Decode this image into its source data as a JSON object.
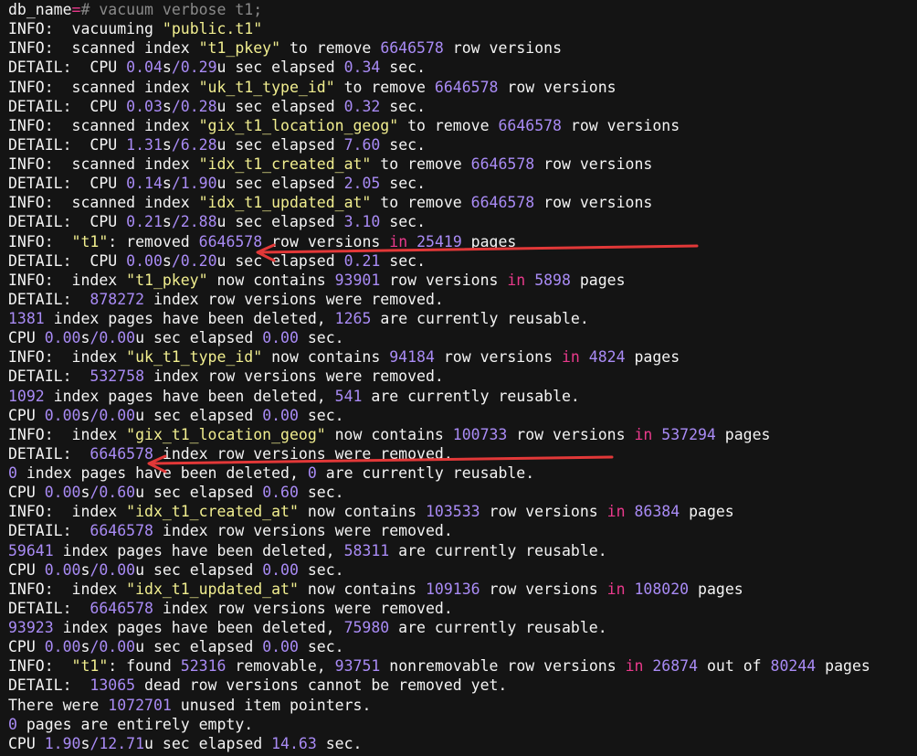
{
  "colors": {
    "background": "#141414",
    "text": "#f4f4f4",
    "string": "#f1ee8f",
    "number": "#a98bf5",
    "keyword_in": "#ea3a8c",
    "command": "#8a8a8a",
    "annotation_arrow": "#e23838"
  },
  "terminal": {
    "lines": [
      {
        "segments": [
          {
            "t": "db_name",
            "c": "t"
          },
          {
            "t": "=",
            "c": "o"
          },
          {
            "t": "# vacuum verbose t1;",
            "c": "c"
          }
        ]
      },
      {
        "segments": [
          {
            "t": "INFO:  vacuuming ",
            "c": "t"
          },
          {
            "t": "\"public.t1\"",
            "c": "s"
          }
        ]
      },
      {
        "segments": [
          {
            "t": "INFO:  scanned index ",
            "c": "t"
          },
          {
            "t": "\"t1_pkey\"",
            "c": "s"
          },
          {
            "t": " to remove ",
            "c": "t"
          },
          {
            "t": "6646578",
            "c": "n"
          },
          {
            "t": " row versions",
            "c": "t"
          }
        ]
      },
      {
        "segments": [
          {
            "t": "DETAIL:  CPU ",
            "c": "t"
          },
          {
            "t": "0.04",
            "c": "n"
          },
          {
            "t": "s",
            "c": "t"
          },
          {
            "t": "/0.29",
            "c": "n"
          },
          {
            "t": "u sec elapsed ",
            "c": "t"
          },
          {
            "t": "0.34",
            "c": "n"
          },
          {
            "t": " sec.",
            "c": "t"
          }
        ]
      },
      {
        "segments": [
          {
            "t": "INFO:  scanned index ",
            "c": "t"
          },
          {
            "t": "\"uk_t1_type_id\"",
            "c": "s"
          },
          {
            "t": " to remove ",
            "c": "t"
          },
          {
            "t": "6646578",
            "c": "n"
          },
          {
            "t": " row versions",
            "c": "t"
          }
        ]
      },
      {
        "segments": [
          {
            "t": "DETAIL:  CPU ",
            "c": "t"
          },
          {
            "t": "0.03",
            "c": "n"
          },
          {
            "t": "s",
            "c": "t"
          },
          {
            "t": "/0.28",
            "c": "n"
          },
          {
            "t": "u sec elapsed ",
            "c": "t"
          },
          {
            "t": "0.32",
            "c": "n"
          },
          {
            "t": " sec.",
            "c": "t"
          }
        ]
      },
      {
        "segments": [
          {
            "t": "INFO:  scanned index ",
            "c": "t"
          },
          {
            "t": "\"gix_t1_location_geog\"",
            "c": "s"
          },
          {
            "t": " to remove ",
            "c": "t"
          },
          {
            "t": "6646578",
            "c": "n"
          },
          {
            "t": " row versions",
            "c": "t"
          }
        ]
      },
      {
        "segments": [
          {
            "t": "DETAIL:  CPU ",
            "c": "t"
          },
          {
            "t": "1.31",
            "c": "n"
          },
          {
            "t": "s",
            "c": "t"
          },
          {
            "t": "/6.28",
            "c": "n"
          },
          {
            "t": "u sec elapsed ",
            "c": "t"
          },
          {
            "t": "7.60",
            "c": "n"
          },
          {
            "t": " sec.",
            "c": "t"
          }
        ]
      },
      {
        "segments": [
          {
            "t": "INFO:  scanned index ",
            "c": "t"
          },
          {
            "t": "\"idx_t1_created_at\"",
            "c": "s"
          },
          {
            "t": " to remove ",
            "c": "t"
          },
          {
            "t": "6646578",
            "c": "n"
          },
          {
            "t": " row versions",
            "c": "t"
          }
        ]
      },
      {
        "segments": [
          {
            "t": "DETAIL:  CPU ",
            "c": "t"
          },
          {
            "t": "0.14",
            "c": "n"
          },
          {
            "t": "s",
            "c": "t"
          },
          {
            "t": "/1.90",
            "c": "n"
          },
          {
            "t": "u sec elapsed ",
            "c": "t"
          },
          {
            "t": "2.05",
            "c": "n"
          },
          {
            "t": " sec.",
            "c": "t"
          }
        ]
      },
      {
        "segments": [
          {
            "t": "INFO:  scanned index ",
            "c": "t"
          },
          {
            "t": "\"idx_t1_updated_at\"",
            "c": "s"
          },
          {
            "t": " to remove ",
            "c": "t"
          },
          {
            "t": "6646578",
            "c": "n"
          },
          {
            "t": " row versions",
            "c": "t"
          }
        ]
      },
      {
        "segments": [
          {
            "t": "DETAIL:  CPU ",
            "c": "t"
          },
          {
            "t": "0.21",
            "c": "n"
          },
          {
            "t": "s",
            "c": "t"
          },
          {
            "t": "/2.88",
            "c": "n"
          },
          {
            "t": "u sec elapsed ",
            "c": "t"
          },
          {
            "t": "3.10",
            "c": "n"
          },
          {
            "t": " sec.",
            "c": "t"
          }
        ]
      },
      {
        "segments": [
          {
            "t": "INFO:  ",
            "c": "t"
          },
          {
            "t": "\"t1\"",
            "c": "s"
          },
          {
            "t": ": removed ",
            "c": "t"
          },
          {
            "t": "6646578",
            "c": "n"
          },
          {
            "t": " row versions ",
            "c": "t"
          },
          {
            "t": "in",
            "c": "k"
          },
          {
            "t": " ",
            "c": "t"
          },
          {
            "t": "25419",
            "c": "n"
          },
          {
            "t": " pages",
            "c": "t"
          }
        ]
      },
      {
        "segments": [
          {
            "t": "DETAIL:  CPU ",
            "c": "t"
          },
          {
            "t": "0.00",
            "c": "n"
          },
          {
            "t": "s",
            "c": "t"
          },
          {
            "t": "/0.20",
            "c": "n"
          },
          {
            "t": "u sec elapsed ",
            "c": "t"
          },
          {
            "t": "0.21",
            "c": "n"
          },
          {
            "t": " sec.",
            "c": "t"
          }
        ]
      },
      {
        "segments": [
          {
            "t": "INFO:  index ",
            "c": "t"
          },
          {
            "t": "\"t1_pkey\"",
            "c": "s"
          },
          {
            "t": " now contains ",
            "c": "t"
          },
          {
            "t": "93901",
            "c": "n"
          },
          {
            "t": " row versions ",
            "c": "t"
          },
          {
            "t": "in",
            "c": "k"
          },
          {
            "t": " ",
            "c": "t"
          },
          {
            "t": "5898",
            "c": "n"
          },
          {
            "t": " pages",
            "c": "t"
          }
        ]
      },
      {
        "segments": [
          {
            "t": "DETAIL:  ",
            "c": "t"
          },
          {
            "t": "878272",
            "c": "n"
          },
          {
            "t": " index row versions were removed.",
            "c": "t"
          }
        ]
      },
      {
        "segments": [
          {
            "t": "1381",
            "c": "n"
          },
          {
            "t": " index pages have been deleted, ",
            "c": "t"
          },
          {
            "t": "1265",
            "c": "n"
          },
          {
            "t": " are currently reusable.",
            "c": "t"
          }
        ]
      },
      {
        "segments": [
          {
            "t": "CPU ",
            "c": "t"
          },
          {
            "t": "0.00",
            "c": "n"
          },
          {
            "t": "s",
            "c": "t"
          },
          {
            "t": "/0.00",
            "c": "n"
          },
          {
            "t": "u sec elapsed ",
            "c": "t"
          },
          {
            "t": "0.00",
            "c": "n"
          },
          {
            "t": " sec.",
            "c": "t"
          }
        ]
      },
      {
        "segments": [
          {
            "t": "INFO:  index ",
            "c": "t"
          },
          {
            "t": "\"uk_t1_type_id\"",
            "c": "s"
          },
          {
            "t": " now contains ",
            "c": "t"
          },
          {
            "t": "94184",
            "c": "n"
          },
          {
            "t": " row versions ",
            "c": "t"
          },
          {
            "t": "in",
            "c": "k"
          },
          {
            "t": " ",
            "c": "t"
          },
          {
            "t": "4824",
            "c": "n"
          },
          {
            "t": " pages",
            "c": "t"
          }
        ]
      },
      {
        "segments": [
          {
            "t": "DETAIL:  ",
            "c": "t"
          },
          {
            "t": "532758",
            "c": "n"
          },
          {
            "t": " index row versions were removed.",
            "c": "t"
          }
        ]
      },
      {
        "segments": [
          {
            "t": "1092",
            "c": "n"
          },
          {
            "t": " index pages have been deleted, ",
            "c": "t"
          },
          {
            "t": "541",
            "c": "n"
          },
          {
            "t": " are currently reusable.",
            "c": "t"
          }
        ]
      },
      {
        "segments": [
          {
            "t": "CPU ",
            "c": "t"
          },
          {
            "t": "0.00",
            "c": "n"
          },
          {
            "t": "s",
            "c": "t"
          },
          {
            "t": "/0.00",
            "c": "n"
          },
          {
            "t": "u sec elapsed ",
            "c": "t"
          },
          {
            "t": "0.00",
            "c": "n"
          },
          {
            "t": " sec.",
            "c": "t"
          }
        ]
      },
      {
        "segments": [
          {
            "t": "INFO:  index ",
            "c": "t"
          },
          {
            "t": "\"gix_t1_location_geog\"",
            "c": "s"
          },
          {
            "t": " now contains ",
            "c": "t"
          },
          {
            "t": "100733",
            "c": "n"
          },
          {
            "t": " row versions ",
            "c": "t"
          },
          {
            "t": "in",
            "c": "k"
          },
          {
            "t": " ",
            "c": "t"
          },
          {
            "t": "537294",
            "c": "n"
          },
          {
            "t": " pages",
            "c": "t"
          }
        ]
      },
      {
        "segments": [
          {
            "t": "DETAIL:  ",
            "c": "t"
          },
          {
            "t": "6646578",
            "c": "n"
          },
          {
            "t": " index row versions were removed.",
            "c": "t"
          }
        ]
      },
      {
        "segments": [
          {
            "t": "0",
            "c": "n"
          },
          {
            "t": " index pages have been deleted, ",
            "c": "t"
          },
          {
            "t": "0",
            "c": "n"
          },
          {
            "t": " are currently reusable.",
            "c": "t"
          }
        ]
      },
      {
        "segments": [
          {
            "t": "CPU ",
            "c": "t"
          },
          {
            "t": "0.00",
            "c": "n"
          },
          {
            "t": "s",
            "c": "t"
          },
          {
            "t": "/0.60",
            "c": "n"
          },
          {
            "t": "u sec elapsed ",
            "c": "t"
          },
          {
            "t": "0.60",
            "c": "n"
          },
          {
            "t": " sec.",
            "c": "t"
          }
        ]
      },
      {
        "segments": [
          {
            "t": "INFO:  index ",
            "c": "t"
          },
          {
            "t": "\"idx_t1_created_at\"",
            "c": "s"
          },
          {
            "t": " now contains ",
            "c": "t"
          },
          {
            "t": "103533",
            "c": "n"
          },
          {
            "t": " row versions ",
            "c": "t"
          },
          {
            "t": "in",
            "c": "k"
          },
          {
            "t": " ",
            "c": "t"
          },
          {
            "t": "86384",
            "c": "n"
          },
          {
            "t": " pages",
            "c": "t"
          }
        ]
      },
      {
        "segments": [
          {
            "t": "DETAIL:  ",
            "c": "t"
          },
          {
            "t": "6646578",
            "c": "n"
          },
          {
            "t": " index row versions were removed.",
            "c": "t"
          }
        ]
      },
      {
        "segments": [
          {
            "t": "59641",
            "c": "n"
          },
          {
            "t": " index pages have been deleted, ",
            "c": "t"
          },
          {
            "t": "58311",
            "c": "n"
          },
          {
            "t": " are currently reusable.",
            "c": "t"
          }
        ]
      },
      {
        "segments": [
          {
            "t": "CPU ",
            "c": "t"
          },
          {
            "t": "0.00",
            "c": "n"
          },
          {
            "t": "s",
            "c": "t"
          },
          {
            "t": "/0.00",
            "c": "n"
          },
          {
            "t": "u sec elapsed ",
            "c": "t"
          },
          {
            "t": "0.00",
            "c": "n"
          },
          {
            "t": " sec.",
            "c": "t"
          }
        ]
      },
      {
        "segments": [
          {
            "t": "INFO:  index ",
            "c": "t"
          },
          {
            "t": "\"idx_t1_updated_at\"",
            "c": "s"
          },
          {
            "t": " now contains ",
            "c": "t"
          },
          {
            "t": "109136",
            "c": "n"
          },
          {
            "t": " row versions ",
            "c": "t"
          },
          {
            "t": "in",
            "c": "k"
          },
          {
            "t": " ",
            "c": "t"
          },
          {
            "t": "108020",
            "c": "n"
          },
          {
            "t": " pages",
            "c": "t"
          }
        ]
      },
      {
        "segments": [
          {
            "t": "DETAIL:  ",
            "c": "t"
          },
          {
            "t": "6646578",
            "c": "n"
          },
          {
            "t": " index row versions were removed.",
            "c": "t"
          }
        ]
      },
      {
        "segments": [
          {
            "t": "93923",
            "c": "n"
          },
          {
            "t": " index pages have been deleted, ",
            "c": "t"
          },
          {
            "t": "75980",
            "c": "n"
          },
          {
            "t": " are currently reusable.",
            "c": "t"
          }
        ]
      },
      {
        "segments": [
          {
            "t": "CPU ",
            "c": "t"
          },
          {
            "t": "0.00",
            "c": "n"
          },
          {
            "t": "s",
            "c": "t"
          },
          {
            "t": "/0.00",
            "c": "n"
          },
          {
            "t": "u sec elapsed ",
            "c": "t"
          },
          {
            "t": "0.00",
            "c": "n"
          },
          {
            "t": " sec.",
            "c": "t"
          }
        ]
      },
      {
        "segments": [
          {
            "t": "INFO:  ",
            "c": "t"
          },
          {
            "t": "\"t1\"",
            "c": "s"
          },
          {
            "t": ": found ",
            "c": "t"
          },
          {
            "t": "52316",
            "c": "n"
          },
          {
            "t": " removable, ",
            "c": "t"
          },
          {
            "t": "93751",
            "c": "n"
          },
          {
            "t": " nonremovable row versions ",
            "c": "t"
          },
          {
            "t": "in",
            "c": "k"
          },
          {
            "t": " ",
            "c": "t"
          },
          {
            "t": "26874",
            "c": "n"
          },
          {
            "t": " out of ",
            "c": "t"
          },
          {
            "t": "80244",
            "c": "n"
          },
          {
            "t": " pages",
            "c": "t"
          }
        ]
      },
      {
        "segments": [
          {
            "t": "DETAIL:  ",
            "c": "t"
          },
          {
            "t": "13065",
            "c": "n"
          },
          {
            "t": " dead row versions cannot be removed yet.",
            "c": "t"
          }
        ]
      },
      {
        "segments": [
          {
            "t": "There were ",
            "c": "t"
          },
          {
            "t": "1072701",
            "c": "n"
          },
          {
            "t": " unused item pointers.",
            "c": "t"
          }
        ]
      },
      {
        "segments": [
          {
            "t": "0",
            "c": "n"
          },
          {
            "t": " pages are entirely empty.",
            "c": "t"
          }
        ]
      },
      {
        "segments": [
          {
            "t": "CPU ",
            "c": "t"
          },
          {
            "t": "1.90",
            "c": "n"
          },
          {
            "t": "s",
            "c": "t"
          },
          {
            "t": "/12.71",
            "c": "n"
          },
          {
            "t": "u sec elapsed ",
            "c": "t"
          },
          {
            "t": "14.63",
            "c": "n"
          },
          {
            "t": " sec.",
            "c": "t"
          }
        ]
      }
    ]
  }
}
